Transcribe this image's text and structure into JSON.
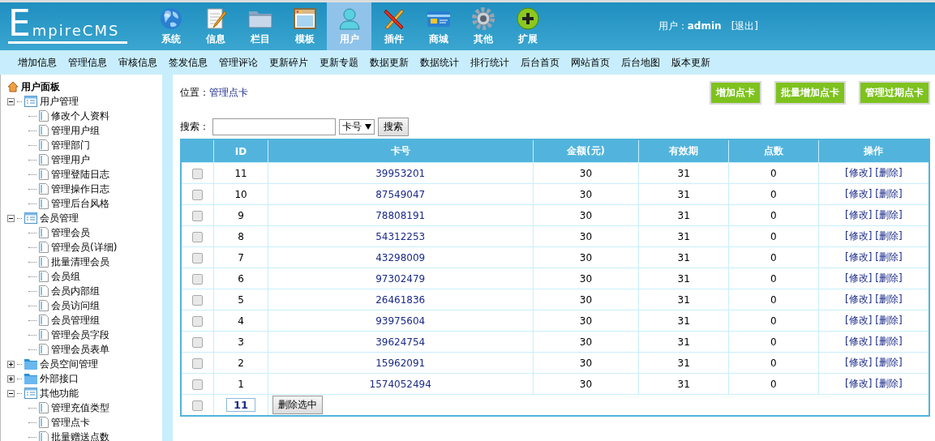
{
  "logo": "EmpireCMS",
  "menu": [
    {
      "label": "系统",
      "selected": false
    },
    {
      "label": "信息",
      "selected": false
    },
    {
      "label": "栏目",
      "selected": false
    },
    {
      "label": "模板",
      "selected": false
    },
    {
      "label": "用户",
      "selected": true
    },
    {
      "label": "插件",
      "selected": false
    },
    {
      "label": "商城",
      "selected": false
    },
    {
      "label": "其他",
      "selected": false
    },
    {
      "label": "扩展",
      "selected": false
    }
  ],
  "user": {
    "label": "用户：",
    "name": "admin",
    "logout": "[退出]"
  },
  "subnav": [
    "增加信息",
    "管理信息",
    "审核信息",
    "签发信息",
    "管理评论",
    "更新碎片",
    "更新专题",
    "数据更新",
    "数据统计",
    "排行统计",
    "后台首页",
    "网站首页",
    "后台地图",
    "版本更新"
  ],
  "sidebar": {
    "title": "用户面板",
    "groups": [
      {
        "label": "用户管理",
        "expanded": true,
        "children": [
          "修改个人资料",
          "管理用户组",
          "管理部门",
          "管理用户",
          "管理登陆日志",
          "管理操作日志",
          "管理后台风格"
        ]
      },
      {
        "label": "会员管理",
        "expanded": true,
        "children": [
          "管理会员",
          "管理会员(详细)",
          "批量清理会员",
          "会员组",
          "会员内部组",
          "会员访问组",
          "会员管理组",
          "管理会员字段",
          "管理会员表单"
        ]
      },
      {
        "label": "会员空间管理",
        "expanded": false
      },
      {
        "label": "外部接口",
        "expanded": false
      },
      {
        "label": "其他功能",
        "expanded": true,
        "children": [
          "管理充值类型",
          "管理点卡",
          "批量赠送点数"
        ]
      }
    ]
  },
  "breadcrumb": {
    "label": "位置：",
    "page": "管理点卡"
  },
  "actions": [
    "增加点卡",
    "批量增加点卡",
    "管理过期点卡"
  ],
  "search": {
    "label": "搜索：",
    "field": "卡号",
    "button": "搜索"
  },
  "table": {
    "columns": [
      "ID",
      "卡号",
      "金额(元)",
      "有效期",
      "点数",
      "操作"
    ],
    "rows": [
      {
        "checked": false,
        "id": "11",
        "card": "39953201",
        "amount": "30",
        "days": "31",
        "points": "0",
        "actions": [
          "[修改]",
          "[删除]"
        ]
      },
      {
        "checked": false,
        "id": "10",
        "card": "87549047",
        "amount": "30",
        "days": "31",
        "points": "0",
        "actions": [
          "[修改]",
          "[删除]"
        ]
      },
      {
        "checked": false,
        "id": "9",
        "card": "78808191",
        "amount": "30",
        "days": "31",
        "points": "0",
        "actions": [
          "[修改]",
          "[删除]"
        ]
      },
      {
        "checked": false,
        "id": "8",
        "card": "54312253",
        "amount": "30",
        "days": "31",
        "points": "0",
        "actions": [
          "[修改]",
          "[删除]"
        ]
      },
      {
        "checked": false,
        "id": "7",
        "card": "43298009",
        "amount": "30",
        "days": "31",
        "points": "0",
        "actions": [
          "[修改]",
          "[删除]"
        ]
      },
      {
        "checked": false,
        "id": "6",
        "card": "97302479",
        "amount": "30",
        "days": "31",
        "points": "0",
        "actions": [
          "[修改]",
          "[删除]"
        ]
      },
      {
        "checked": false,
        "id": "5",
        "card": "26461836",
        "amount": "30",
        "days": "31",
        "points": "0",
        "actions": [
          "[修改]",
          "[删除]"
        ]
      },
      {
        "checked": false,
        "id": "4",
        "card": "93975604",
        "amount": "30",
        "days": "31",
        "points": "0",
        "actions": [
          "[修改]",
          "[删除]"
        ]
      },
      {
        "checked": false,
        "id": "3",
        "card": "39624754",
        "amount": "30",
        "days": "31",
        "points": "0",
        "actions": [
          "[修改]",
          "[删除]"
        ]
      },
      {
        "checked": false,
        "id": "2",
        "card": "15962091",
        "amount": "30",
        "days": "31",
        "points": "0",
        "actions": [
          "[修改]",
          "[删除]"
        ]
      },
      {
        "checked": false,
        "id": "1",
        "card": "1574052494",
        "amount": "30",
        "days": "31",
        "points": "0",
        "actions": [
          "[修改]",
          "[删除]"
        ]
      }
    ],
    "footer": {
      "check_all": false,
      "count": "11",
      "button": "删除选中"
    }
  }
}
